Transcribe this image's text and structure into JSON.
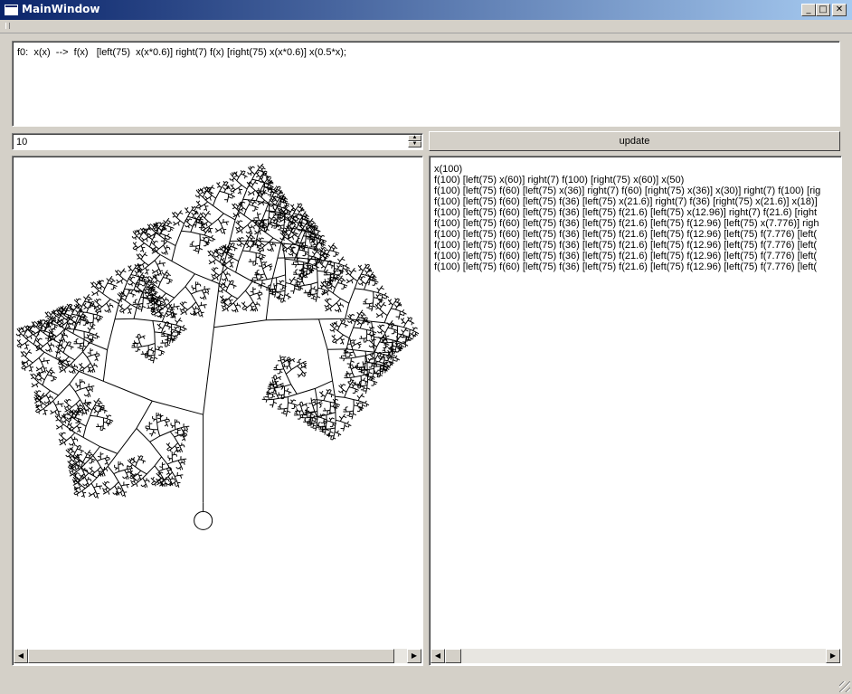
{
  "window": {
    "title": "MainWindow",
    "minimize_glyph": "_",
    "maximize_glyph": "□",
    "close_glyph": "✕"
  },
  "rule_editor": {
    "text": "f0:  x(x)  -->  f(x)   [left(75)  x(x*0.6)] right(7) f(x) [right(75) x(x*0.6)] x(0.5*x);"
  },
  "iterations": {
    "value": "10"
  },
  "update_button": {
    "label": "update"
  },
  "output_lines": [
    "x(100)",
    "f(100) [left(75) x(60)] right(7) f(100) [right(75) x(60)] x(50)",
    "f(100) [left(75) f(60) [left(75) x(36)] right(7) f(60) [right(75) x(36)] x(30)] right(7) f(100) [rig",
    "f(100) [left(75) f(60) [left(75) f(36) [left(75) x(21.6)] right(7) f(36) [right(75) x(21.6)] x(18)]",
    "f(100) [left(75) f(60) [left(75) f(36) [left(75) f(21.6) [left(75) x(12.96)] right(7) f(21.6) [right",
    "f(100) [left(75) f(60) [left(75) f(36) [left(75) f(21.6) [left(75) f(12.96) [left(75) x(7.776)] righ",
    "f(100) [left(75) f(60) [left(75) f(36) [left(75) f(21.6) [left(75) f(12.96) [left(75) f(7.776) [left(",
    "f(100) [left(75) f(60) [left(75) f(36) [left(75) f(21.6) [left(75) f(12.96) [left(75) f(7.776) [left(",
    "f(100) [left(75) f(60) [left(75) f(36) [left(75) f(21.6) [left(75) f(12.96) [left(75) f(7.776) [left(",
    "f(100) [left(75) f(60) [left(75) f(36) [left(75) f(21.6) [left(75) f(12.96) [left(75) f(7.776) [left("
  ],
  "icons": {
    "scroll_left": "◀",
    "scroll_right": "▶",
    "spin_up": "▲",
    "spin_down": "▼"
  }
}
